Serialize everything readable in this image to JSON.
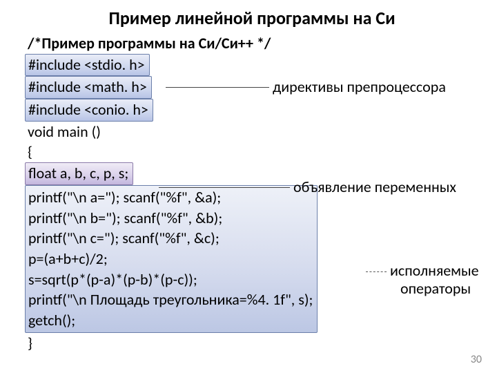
{
  "title": "Пример линейной  программы на Си",
  "code": {
    "comment": "/*Пример программы на Си/Си++  */",
    "inc1": "#include <stdio. h>",
    "inc2": "#include <math. h>",
    "inc3": "#include <conio. h>",
    "main": "void main ()",
    "brace_open": "{",
    "decl": "float a, b, c, p, s;",
    "pa": "printf(\"\\n a=\"); scanf(\"%f\", &a);",
    "pb": "printf(\"\\n b=\"); scanf(\"%f\", &b);",
    "pc": "printf(\"\\n c=\"); scanf(\"%f\", &c);",
    "pcalc": "p=(a+b+c)/2;",
    "scalc": "s=sqrt(p*(p-a)*(p-b)*(p-c));",
    "pout": "printf(\"\\n Площадь треугольника=%4. 1f\", s);",
    "getch": "getch();",
    "brace_close": "}"
  },
  "labels": {
    "preproc": "директивы препроцессора",
    "decl": "объявление переменных",
    "exec1": "исполняемые",
    "exec2": "операторы"
  },
  "page": "30"
}
